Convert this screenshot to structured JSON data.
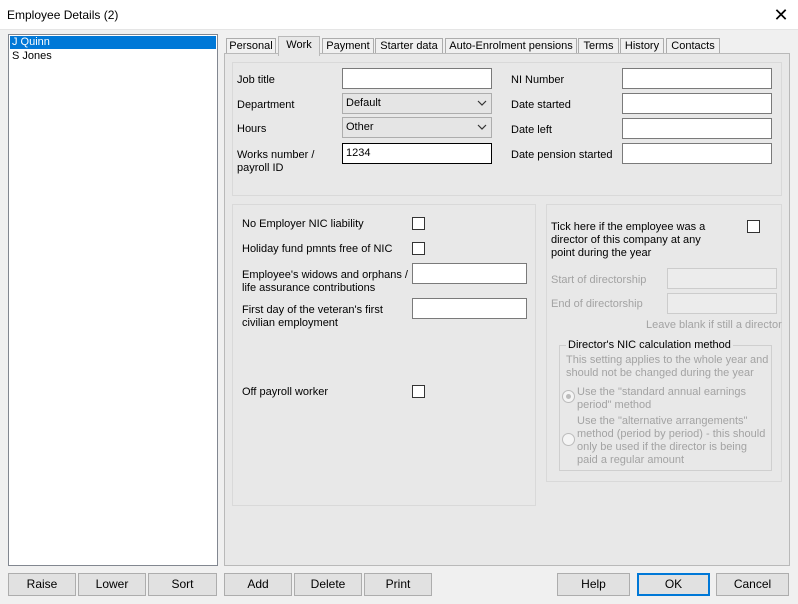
{
  "window": {
    "title": "Employee Details (2)"
  },
  "employees": [
    "J Quinn",
    "S Jones"
  ],
  "tabs": [
    "Personal",
    "Work",
    "Payment",
    "Starter data",
    "Auto-Enrolment pensions",
    "Terms",
    "History",
    "Contacts"
  ],
  "active_tab": "Work",
  "work": {
    "job_title_label": "Job title",
    "job_title_value": "",
    "department_label": "Department",
    "department_value": "Default",
    "hours_label": "Hours",
    "hours_value": "Other",
    "works_number_label_1": "Works number /",
    "works_number_label_2": "payroll ID",
    "works_number_value": "1234",
    "ni_number_label": "NI Number",
    "date_started_label": "Date started",
    "date_left_label": "Date left",
    "date_pension_started_label": "Date pension started"
  },
  "nic": {
    "no_employer_nic_label": "No Employer NIC liability",
    "holiday_fund_label": "Holiday fund pmnts free of NIC",
    "widows_label_1": "Employee's widows and orphans /",
    "widows_label_2": "life assurance contributions",
    "veteran_label_1": "First day of the veteran's first",
    "veteran_label_2": "civilian employment",
    "off_payroll_label": "Off payroll worker"
  },
  "director": {
    "tick_label_1": "Tick here if the employee was a",
    "tick_label_2": "director of this company at any",
    "tick_label_3": "point during the year",
    "start_label": "Start of directorship",
    "end_label": "End of directorship",
    "leave_blank_note": "Leave blank if still a director",
    "method_legend": "Director's NIC calculation method",
    "method_note_1": "This setting applies to the whole year and",
    "method_note_2": "should not be changed during the year",
    "standard_label_1": "Use the \"standard annual earnings",
    "standard_label_2": "period\" method",
    "alt_label_1": "Use the \"alternative arrangements\"",
    "alt_label_2": "method (period by period) - this should",
    "alt_label_3": "only be used if the director is being",
    "alt_label_4": "paid a regular amount"
  },
  "buttons": {
    "raise": "Raise",
    "lower": "Lower",
    "sort": "Sort",
    "add": "Add",
    "delete": "Delete",
    "print": "Print",
    "help": "Help",
    "ok": "OK",
    "cancel": "Cancel"
  },
  "colors": {
    "selection": "#0078d7",
    "panel_bg": "#e8e8e8",
    "dialog_bg": "#f0f0f0"
  }
}
